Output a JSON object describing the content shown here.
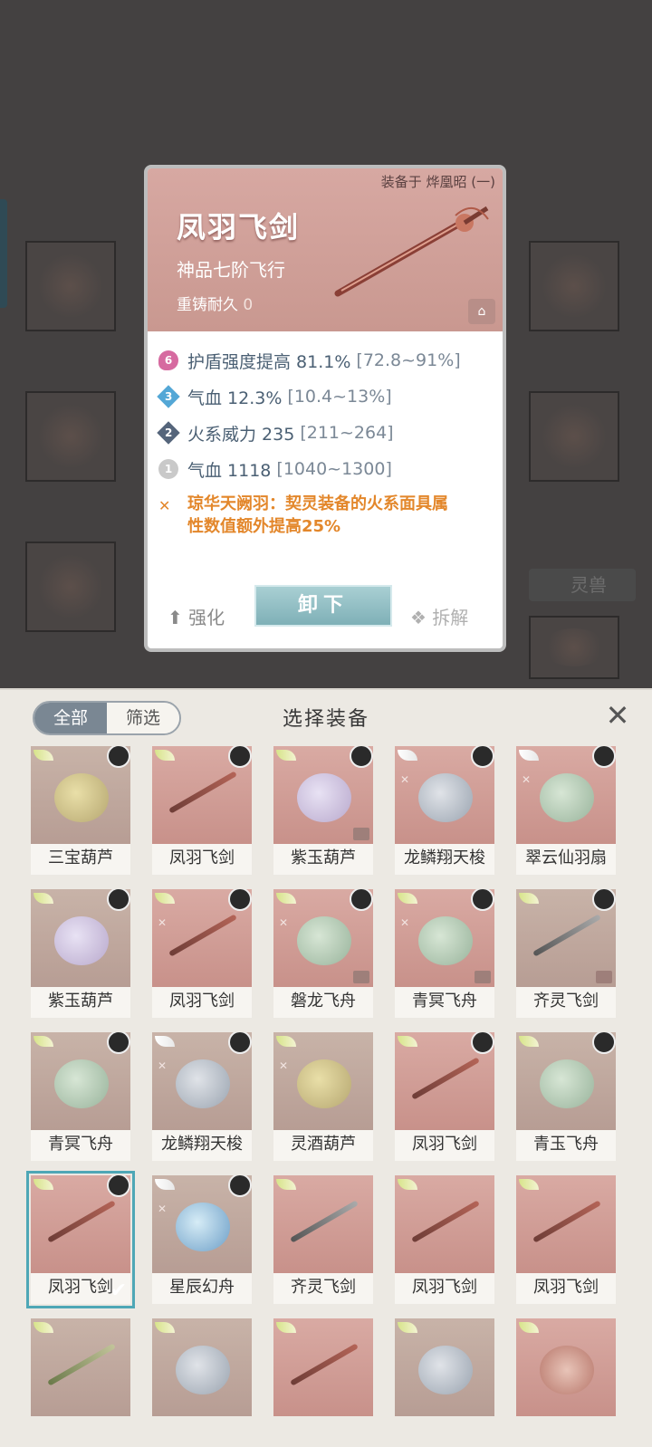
{
  "popup": {
    "equipped_on": "装备于 烨凰昭 (一)",
    "name": "凤羽飞剑",
    "grade": "神品七阶飞行",
    "recast_label": "重铸耐久",
    "recast_value": "0",
    "attributes": [
      {
        "tier": "6",
        "text": "护盾强度提高 81.1%",
        "range": "[72.8~91%]"
      },
      {
        "tier": "3",
        "text": "气血 12.3%",
        "range": "[10.4~13%]"
      },
      {
        "tier": "2",
        "text": "火系威力 235",
        "range": "[211~264]"
      },
      {
        "tier": "1",
        "text": "气血 1118",
        "range": "[1040~1300]"
      }
    ],
    "special_line1": "琼华天阙羽：契灵装备的火系面具属",
    "special_line2": "性数值额外提高25%",
    "enhance_label": "强化",
    "unequip_label": "卸下",
    "dismantle_label": "拆解"
  },
  "background": {
    "side_tag": "灵兽"
  },
  "sheet": {
    "tab_all": "全部",
    "tab_filter": "筛选",
    "title": "选择装备",
    "close_icon": "close-icon"
  },
  "items": [
    "三宝葫芦",
    "凤羽飞剑",
    "紫玉葫芦",
    "龙鳞翔天梭",
    "翠云仙羽扇",
    "紫玉葫芦",
    "凤羽飞剑",
    "磐龙飞舟",
    "青冥飞舟",
    "齐灵飞剑",
    "青冥飞舟",
    "龙鳞翔天梭",
    "灵酒葫芦",
    "凤羽飞剑",
    "青玉飞舟",
    "凤羽飞剑",
    "星辰幻舟",
    "齐灵飞剑",
    "凤羽飞剑",
    "凤羽飞剑"
  ]
}
